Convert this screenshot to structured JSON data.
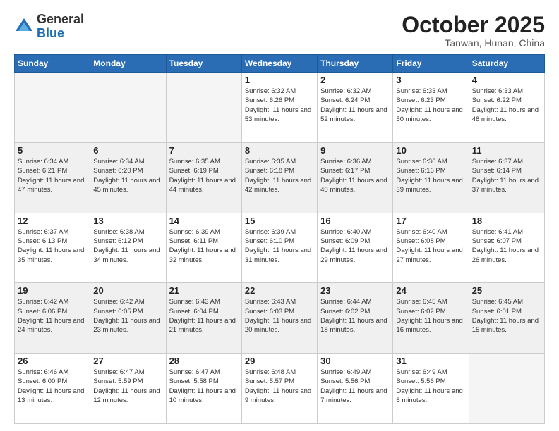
{
  "header": {
    "logo_general": "General",
    "logo_blue": "Blue",
    "month": "October 2025",
    "location": "Tanwan, Hunan, China"
  },
  "days_of_week": [
    "Sunday",
    "Monday",
    "Tuesday",
    "Wednesday",
    "Thursday",
    "Friday",
    "Saturday"
  ],
  "weeks": [
    [
      {
        "day": "",
        "info": "",
        "empty": true
      },
      {
        "day": "",
        "info": "",
        "empty": true
      },
      {
        "day": "",
        "info": "",
        "empty": true
      },
      {
        "day": "1",
        "info": "Sunrise: 6:32 AM\nSunset: 6:26 PM\nDaylight: 11 hours\nand 53 minutes."
      },
      {
        "day": "2",
        "info": "Sunrise: 6:32 AM\nSunset: 6:24 PM\nDaylight: 11 hours\nand 52 minutes."
      },
      {
        "day": "3",
        "info": "Sunrise: 6:33 AM\nSunset: 6:23 PM\nDaylight: 11 hours\nand 50 minutes."
      },
      {
        "day": "4",
        "info": "Sunrise: 6:33 AM\nSunset: 6:22 PM\nDaylight: 11 hours\nand 48 minutes."
      }
    ],
    [
      {
        "day": "5",
        "info": "Sunrise: 6:34 AM\nSunset: 6:21 PM\nDaylight: 11 hours\nand 47 minutes.",
        "shaded": true
      },
      {
        "day": "6",
        "info": "Sunrise: 6:34 AM\nSunset: 6:20 PM\nDaylight: 11 hours\nand 45 minutes.",
        "shaded": true
      },
      {
        "day": "7",
        "info": "Sunrise: 6:35 AM\nSunset: 6:19 PM\nDaylight: 11 hours\nand 44 minutes.",
        "shaded": true
      },
      {
        "day": "8",
        "info": "Sunrise: 6:35 AM\nSunset: 6:18 PM\nDaylight: 11 hours\nand 42 minutes.",
        "shaded": true
      },
      {
        "day": "9",
        "info": "Sunrise: 6:36 AM\nSunset: 6:17 PM\nDaylight: 11 hours\nand 40 minutes.",
        "shaded": true
      },
      {
        "day": "10",
        "info": "Sunrise: 6:36 AM\nSunset: 6:16 PM\nDaylight: 11 hours\nand 39 minutes.",
        "shaded": true
      },
      {
        "day": "11",
        "info": "Sunrise: 6:37 AM\nSunset: 6:14 PM\nDaylight: 11 hours\nand 37 minutes.",
        "shaded": true
      }
    ],
    [
      {
        "day": "12",
        "info": "Sunrise: 6:37 AM\nSunset: 6:13 PM\nDaylight: 11 hours\nand 35 minutes."
      },
      {
        "day": "13",
        "info": "Sunrise: 6:38 AM\nSunset: 6:12 PM\nDaylight: 11 hours\nand 34 minutes."
      },
      {
        "day": "14",
        "info": "Sunrise: 6:39 AM\nSunset: 6:11 PM\nDaylight: 11 hours\nand 32 minutes."
      },
      {
        "day": "15",
        "info": "Sunrise: 6:39 AM\nSunset: 6:10 PM\nDaylight: 11 hours\nand 31 minutes."
      },
      {
        "day": "16",
        "info": "Sunrise: 6:40 AM\nSunset: 6:09 PM\nDaylight: 11 hours\nand 29 minutes."
      },
      {
        "day": "17",
        "info": "Sunrise: 6:40 AM\nSunset: 6:08 PM\nDaylight: 11 hours\nand 27 minutes."
      },
      {
        "day": "18",
        "info": "Sunrise: 6:41 AM\nSunset: 6:07 PM\nDaylight: 11 hours\nand 26 minutes."
      }
    ],
    [
      {
        "day": "19",
        "info": "Sunrise: 6:42 AM\nSunset: 6:06 PM\nDaylight: 11 hours\nand 24 minutes.",
        "shaded": true
      },
      {
        "day": "20",
        "info": "Sunrise: 6:42 AM\nSunset: 6:05 PM\nDaylight: 11 hours\nand 23 minutes.",
        "shaded": true
      },
      {
        "day": "21",
        "info": "Sunrise: 6:43 AM\nSunset: 6:04 PM\nDaylight: 11 hours\nand 21 minutes.",
        "shaded": true
      },
      {
        "day": "22",
        "info": "Sunrise: 6:43 AM\nSunset: 6:03 PM\nDaylight: 11 hours\nand 20 minutes.",
        "shaded": true
      },
      {
        "day": "23",
        "info": "Sunrise: 6:44 AM\nSunset: 6:02 PM\nDaylight: 11 hours\nand 18 minutes.",
        "shaded": true
      },
      {
        "day": "24",
        "info": "Sunrise: 6:45 AM\nSunset: 6:02 PM\nDaylight: 11 hours\nand 16 minutes.",
        "shaded": true
      },
      {
        "day": "25",
        "info": "Sunrise: 6:45 AM\nSunset: 6:01 PM\nDaylight: 11 hours\nand 15 minutes.",
        "shaded": true
      }
    ],
    [
      {
        "day": "26",
        "info": "Sunrise: 6:46 AM\nSunset: 6:00 PM\nDaylight: 11 hours\nand 13 minutes."
      },
      {
        "day": "27",
        "info": "Sunrise: 6:47 AM\nSunset: 5:59 PM\nDaylight: 11 hours\nand 12 minutes."
      },
      {
        "day": "28",
        "info": "Sunrise: 6:47 AM\nSunset: 5:58 PM\nDaylight: 11 hours\nand 10 minutes."
      },
      {
        "day": "29",
        "info": "Sunrise: 6:48 AM\nSunset: 5:57 PM\nDaylight: 11 hours\nand 9 minutes."
      },
      {
        "day": "30",
        "info": "Sunrise: 6:49 AM\nSunset: 5:56 PM\nDaylight: 11 hours\nand 7 minutes."
      },
      {
        "day": "31",
        "info": "Sunrise: 6:49 AM\nSunset: 5:56 PM\nDaylight: 11 hours\nand 6 minutes."
      },
      {
        "day": "",
        "info": "",
        "empty": true
      }
    ]
  ]
}
